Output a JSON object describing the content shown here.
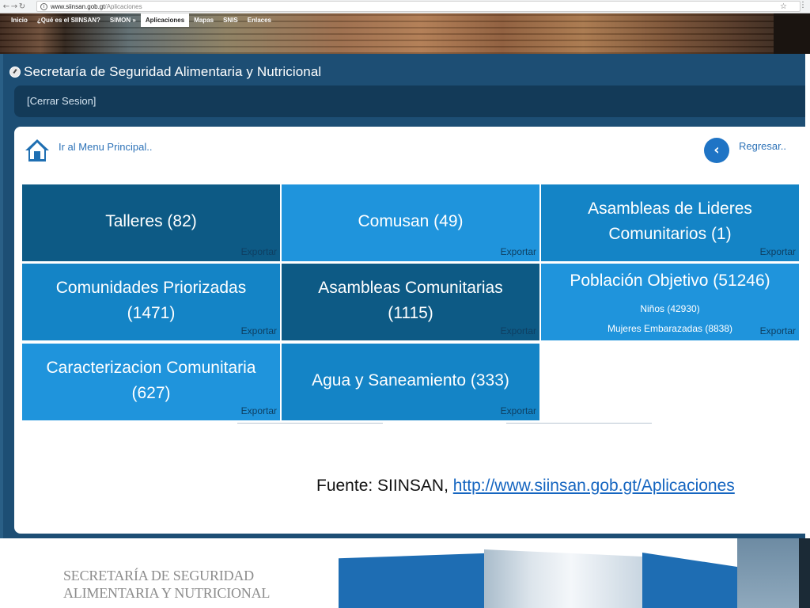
{
  "browser": {
    "back_icon": "arrow-left-icon",
    "forward_icon": "arrow-right-icon",
    "reload_icon": "reload-icon",
    "url_host": "www.siinsan.gob.gt",
    "url_path": "/Aplicaciones"
  },
  "site_nav": {
    "items": [
      {
        "label": "Inicio"
      },
      {
        "label": "¿Qué es el SIINSAN?"
      },
      {
        "label": "SIMON »"
      },
      {
        "label": "Aplicaciones"
      },
      {
        "label": "Mapas"
      },
      {
        "label": "SNIS"
      },
      {
        "label": "Enlaces"
      }
    ],
    "active": "Aplicaciones"
  },
  "app": {
    "title": "Secretaría de Seguridad Alimentaria y Nutricional",
    "logout": "[Cerrar Sesion]"
  },
  "panel": {
    "home_label": "Ir al Menu Principal..",
    "back_label": "Regresar..",
    "back_glyph": "‹"
  },
  "tiles": [
    {
      "title": "Talleres (82)",
      "export": "Exportar"
    },
    {
      "title": "Comusan (49)",
      "export": "Exportar"
    },
    {
      "title_line1": "Asambleas de Lideres",
      "title_line2": "Comunitarios (1)",
      "export": "Exportar"
    },
    {
      "title_line1": "Comunidades Priorizadas",
      "title_line2": "(1471)",
      "export": "Exportar"
    },
    {
      "title_line1": "Asambleas Comunitarias",
      "title_line2": "(1115)",
      "export": "Exportar"
    },
    {
      "title": "Población Objetivo (51246)",
      "sub1": "Niños (42930)",
      "sub2": "Mujeres Embarazadas (8838)",
      "export": "Exportar"
    },
    {
      "title_line1": "Caracterizacion Comunitaria",
      "title_line2": "(627)",
      "export": "Exportar"
    },
    {
      "title": "Agua y Saneamiento (333)",
      "export": "Exportar"
    }
  ],
  "source": {
    "prefix": "Fuente: SIINSAN, ",
    "url": "http://www.siinsan.gob.gt/Aplicaciones"
  },
  "footer": {
    "org_line1": "SECRETARÍA DE SEGURIDAD",
    "org_line2": "ALIMENTARIA Y NUTRICIONAL"
  },
  "colors": {
    "app_navy": "#1d4e74",
    "session_bar": "#133a58",
    "tile_dark": "#0d5a85",
    "tile_mid": "#1484c6",
    "tile_bright": "#1f94dc",
    "link_blue": "#2e73b8"
  }
}
